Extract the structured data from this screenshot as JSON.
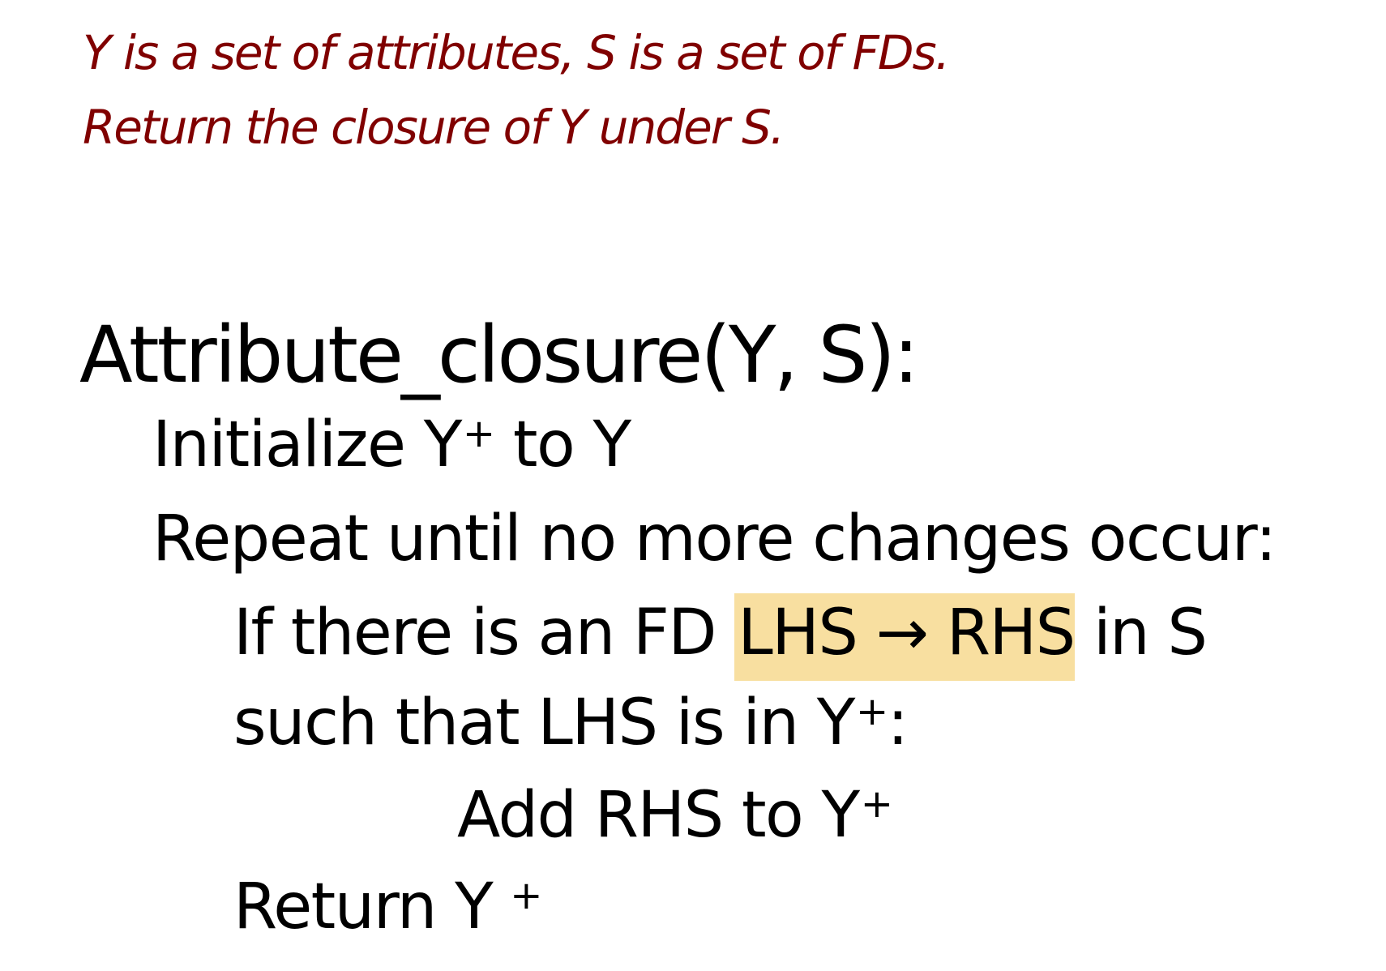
{
  "intro": {
    "line1": "Y is a set of attributes, S is a set of FDs.",
    "line2": "Return the closure of Y under S."
  },
  "algorithm": {
    "title": "Attribute_closure(Y, S):",
    "init_text": "Initialize Y",
    "init_sup": "+",
    "init_tail": " to Y",
    "repeat_text": "Repeat until no more changes occur:",
    "if_text": "If there is an FD ",
    "if_highlight": "LHS → RHS",
    "if_tail": " in S",
    "such_text": "such that LHS is in Y",
    "such_sup": "+",
    "such_tail": ":",
    "add_text": "Add RHS to Y",
    "add_sup": "+",
    "return_text": "Return Y",
    "return_sup": "+"
  },
  "colors": {
    "intro_text": "#800000",
    "highlight": "#f8dfa0",
    "code_text": "#000000"
  }
}
